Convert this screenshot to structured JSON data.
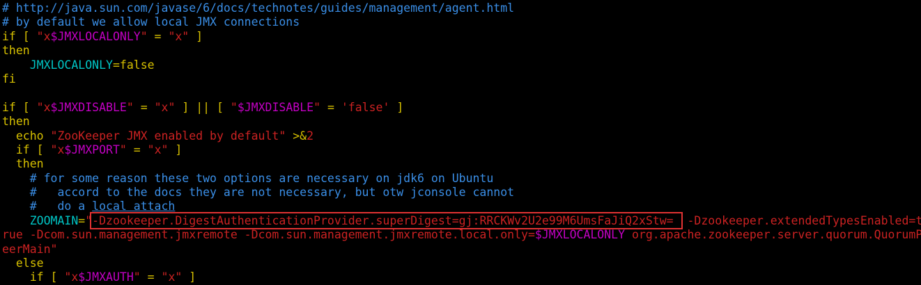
{
  "editor": {
    "lines": [
      [
        {
          "t": "# http://java.sun.com/javase/6/docs/technotes/guides/management/agent.html",
          "c": "cmt"
        }
      ],
      [
        {
          "t": "# by default we allow local JMX connections",
          "c": "cmt"
        }
      ],
      [
        {
          "t": "if [ ",
          "c": "kw"
        },
        {
          "t": "\"x",
          "c": "str"
        },
        {
          "t": "$JMXLOCALONLY",
          "c": "var"
        },
        {
          "t": "\"",
          "c": "str"
        },
        {
          "t": " = ",
          "c": "kw"
        },
        {
          "t": "\"x\"",
          "c": "str"
        },
        {
          "t": " ]",
          "c": "kw"
        }
      ],
      [
        {
          "t": "then",
          "c": "kw"
        }
      ],
      [
        {
          "t": "    ",
          "c": "plain"
        },
        {
          "t": "JMXLOCALONLY",
          "c": "ident"
        },
        {
          "t": "=false",
          "c": "kw"
        }
      ],
      [
        {
          "t": "fi",
          "c": "kw"
        }
      ],
      [
        {
          "t": "",
          "c": "plain"
        }
      ],
      [
        {
          "t": "if [ ",
          "c": "kw"
        },
        {
          "t": "\"x",
          "c": "str"
        },
        {
          "t": "$JMXDISABLE",
          "c": "var"
        },
        {
          "t": "\"",
          "c": "str"
        },
        {
          "t": " = ",
          "c": "kw"
        },
        {
          "t": "\"x\"",
          "c": "str"
        },
        {
          "t": " ] || [ ",
          "c": "kw"
        },
        {
          "t": "\"",
          "c": "str"
        },
        {
          "t": "$JMXDISABLE",
          "c": "var"
        },
        {
          "t": "\"",
          "c": "str"
        },
        {
          "t": " = ",
          "c": "kw"
        },
        {
          "t": "'false'",
          "c": "str"
        },
        {
          "t": " ]",
          "c": "kw"
        }
      ],
      [
        {
          "t": "then",
          "c": "kw"
        }
      ],
      [
        {
          "t": "  echo ",
          "c": "kw"
        },
        {
          "t": "\"ZooKeeper JMX enabled by default\"",
          "c": "str"
        },
        {
          "t": " >&",
          "c": "kw"
        },
        {
          "t": "2",
          "c": "str"
        }
      ],
      [
        {
          "t": "  if [ ",
          "c": "kw"
        },
        {
          "t": "\"x",
          "c": "str"
        },
        {
          "t": "$JMXPORT",
          "c": "var"
        },
        {
          "t": "\"",
          "c": "str"
        },
        {
          "t": " = ",
          "c": "kw"
        },
        {
          "t": "\"x\"",
          "c": "str"
        },
        {
          "t": " ]",
          "c": "kw"
        }
      ],
      [
        {
          "t": "  then",
          "c": "kw"
        }
      ],
      [
        {
          "t": "    # for some reason these two options are necessary on jdk6 on Ubuntu",
          "c": "cmt"
        }
      ],
      [
        {
          "t": "    #   accord to the docs they are not necessary, but otw jconsole cannot",
          "c": "cmt"
        }
      ],
      [
        {
          "t": "    #   do a ",
          "c": "cmt"
        },
        {
          "t": "local attach",
          "c": "cmt",
          "u": true
        }
      ],
      [
        {
          "t": "    ",
          "c": "plain"
        },
        {
          "t": "ZOOMAIN",
          "c": "ident"
        },
        {
          "t": "=",
          "c": "kw"
        },
        {
          "t": "\"",
          "c": "str"
        },
        {
          "t": "-Dzookeeper.DigestAuthenticationProvider.superDigest=gj:RRCKWv2U2e99M6UmsFaJiQ2xStw= ",
          "c": "str",
          "box": true
        },
        {
          "t": " -Dzookeeper.extendedTypesEnabled=t",
          "c": "str"
        }
      ],
      [
        {
          "t": "rue -Dcom.sun.management.jmxremote -Dcom.sun.management.jmxremote.local.only=",
          "c": "str"
        },
        {
          "t": "$JMXLOCALONLY",
          "c": "var"
        },
        {
          "t": " org.apache.zookeeper.server.quorum.QuorumP",
          "c": "str"
        }
      ],
      [
        {
          "t": "eerMain\"",
          "c": "str"
        }
      ],
      [
        {
          "t": "  else",
          "c": "kw"
        }
      ],
      [
        {
          "t": "    if [ ",
          "c": "kw"
        },
        {
          "t": "\"x",
          "c": "str"
        },
        {
          "t": "$JMXAUTH",
          "c": "var"
        },
        {
          "t": "\"",
          "c": "str"
        },
        {
          "t": " = ",
          "c": "kw"
        },
        {
          "t": "\"x\"",
          "c": "str"
        },
        {
          "t": " ]",
          "c": "kw"
        }
      ]
    ],
    "colors": {
      "background": "#000000",
      "comment": "#3a8ee6",
      "keyword": "#d7c000",
      "string": "#cc2222",
      "variable": "#c300c3",
      "identifier": "#00c5c5",
      "highlight_box": "#e23333"
    }
  }
}
